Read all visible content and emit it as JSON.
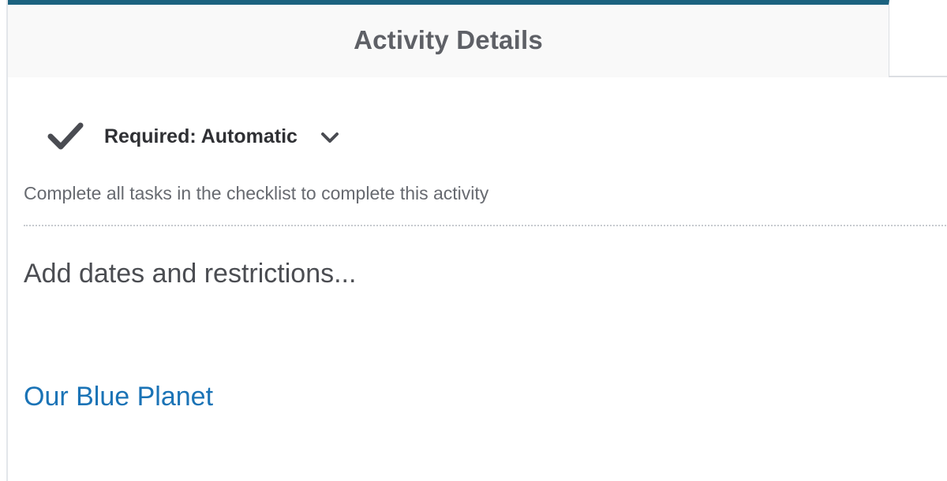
{
  "tab": {
    "title": "Activity Details",
    "accent_color": "#1b627f"
  },
  "completion": {
    "icon": "checkmark-icon",
    "label": "Required: Automatic",
    "dropdown_icon": "chevron-down-icon",
    "description": "Complete all tasks in the checklist to complete this activity"
  },
  "restrictions": {
    "link_label": "Add dates and restrictions..."
  },
  "topic": {
    "link_label": "Our Blue Planet",
    "link_color": "#1a73b6"
  }
}
